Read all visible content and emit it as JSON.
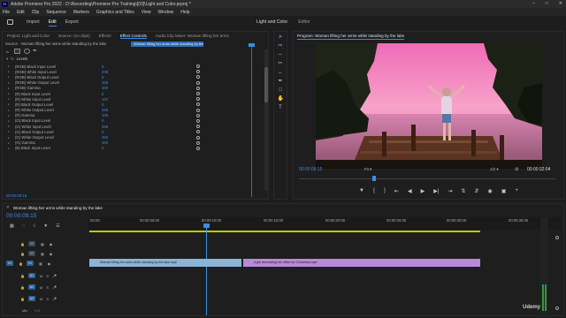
{
  "app": {
    "title": "Adobe Premiere Pro 2022 - D:\\Recording\\Premiere Pro Training\\[03]\\Light and Color.prproj *",
    "logo": "Pr"
  },
  "menu": [
    "File",
    "Edit",
    "Clip",
    "Sequence",
    "Markers",
    "Graphics and Titles",
    "View",
    "Window",
    "Help"
  ],
  "workspace_tabs": [
    "Import",
    "Edit",
    "Export"
  ],
  "workspace_active": "Edit",
  "workspace_right": [
    "Light and Color",
    "Editor"
  ],
  "effects_panel": {
    "tabs": [
      "Project: Light and Color",
      "Source: (no clips)",
      "Effects",
      "Effect Controls",
      "Audio Clip Mixer: Woman lifting her arms"
    ],
    "active_tab": "Effect Controls",
    "source_line": "Source · Woman lifting her arms while standing by the lake",
    "clip_tab": "Woman lifting her arms while standing by the lake",
    "effect_name": "Levels",
    "rows": [
      {
        "label": "(RGB) Black Input Level",
        "value": "0"
      },
      {
        "label": "(RGB) White Input Level",
        "value": "208"
      },
      {
        "label": "(RGB) Black Output Level",
        "value": "0"
      },
      {
        "label": "(RGB) White Output Level",
        "value": "255"
      },
      {
        "label": "(RGB) Gamma",
        "value": "100"
      },
      {
        "label": "(R) Black Input Level",
        "value": "0"
      },
      {
        "label": "(R) White Input Level",
        "value": "147"
      },
      {
        "label": "(R) Black Output Level",
        "value": "0"
      },
      {
        "label": "(R) White Output Level",
        "value": "255"
      },
      {
        "label": "(R) Gamma",
        "value": "100"
      },
      {
        "label": "(G) Black Input Level",
        "value": "0"
      },
      {
        "label": "(G) White Input Level",
        "value": "255"
      },
      {
        "label": "(G) Black Output Level",
        "value": "0"
      },
      {
        "label": "(G) White Output Level",
        "value": "255"
      },
      {
        "label": "(G) Gamma",
        "value": "100"
      },
      {
        "label": "(B) Black Input Level",
        "value": "0"
      }
    ],
    "timecode": "00:00:09:15"
  },
  "program_monitor": {
    "title": "Program: Woman lifting her arms while standing by the lake",
    "timecode": "00:00:09:15",
    "fit": "Fit",
    "resolution": "1/2",
    "duration": "00:00:32:04",
    "playhead_fraction": 0.29
  },
  "timeline": {
    "tab": "Woman lifting her arms while standing by the lake",
    "timecode": "00:00:09:15",
    "ruler": [
      ":00:00",
      "00:00:05:00",
      "00:00:10:00",
      "00:00:15:00",
      "00:00:20:00",
      "00:00:25:00",
      "00:00:30:00",
      "00:00:35:00"
    ],
    "tracks": [
      "V3",
      "V2",
      "V1",
      "A1",
      "A2",
      "A3",
      "Mix"
    ],
    "clips": [
      {
        "label": "Woman lifting her arms while standing by the lake.mpe",
        "color": "#8ab4d8"
      },
      {
        "label": "A girl decorating the office for Christmas.mpe",
        "color": "#b78ad8"
      }
    ],
    "mix_value": "0.0"
  },
  "watermark": "Udemy",
  "colors": {
    "accent": "#2d8ceb",
    "value_blue": "#3a8ee6",
    "clip_blue": "#8ab4d8",
    "clip_purple": "#b78ad8"
  }
}
